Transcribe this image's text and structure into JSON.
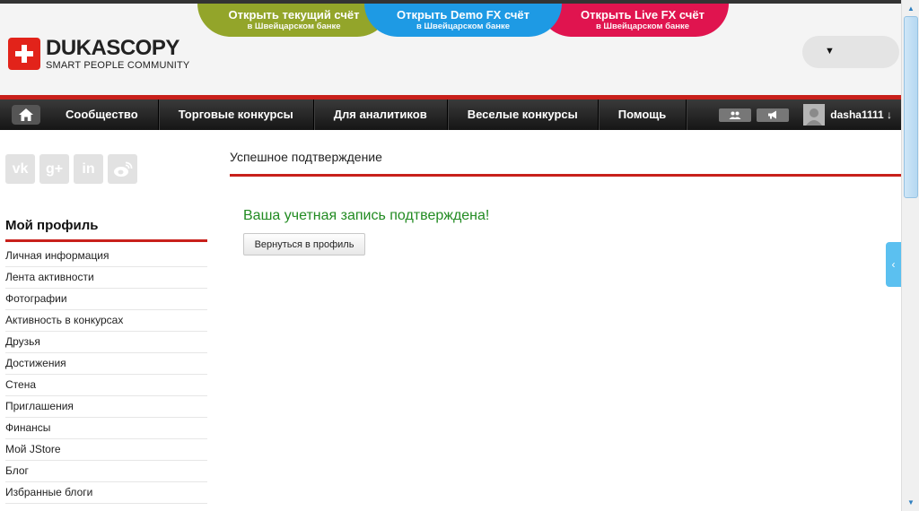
{
  "header": {
    "logo_name": "DUKASCOPY",
    "logo_tagline": "SMART PEOPLE COMMUNITY",
    "promos": [
      {
        "line1": "Открыть текущий счёт",
        "line2": "в Швейцарском банке"
      },
      {
        "line1": "Открыть Demo FX счёт",
        "line2": "в Швейцарском банке"
      },
      {
        "line1": "Открыть Live FX счёт",
        "line2": "в Швейцарском банке"
      }
    ],
    "lang_arrow": "▼"
  },
  "nav": {
    "items": [
      "Сообщество",
      "Торговые конкурсы",
      "Для аналитиков",
      "Веселые конкурсы",
      "Помощь"
    ],
    "username": "dasha1111 ↓"
  },
  "sidebar": {
    "social": [
      "vk",
      "g+",
      "in"
    ],
    "profile_title": "Мой профиль",
    "menu": [
      "Личная информация",
      "Лента активности",
      "Фотографии",
      "Активность в конкурсах",
      "Друзья",
      "Достижения",
      "Стена",
      "Приглашения",
      "Финансы",
      "Мой JStore",
      "Блог",
      "Избранные блоги"
    ]
  },
  "main": {
    "heading": "Успешное подтверждение",
    "success_message": "Ваша учетная запись подтверждена!",
    "back_button": "Вернуться в профиль"
  },
  "side_tab_glyph": "‹",
  "colors": {
    "brand_red": "#c8201b",
    "promo_green": "#93a52a",
    "promo_blue": "#1e9ae4",
    "promo_red": "#e0144f",
    "success_green": "#228b22"
  }
}
